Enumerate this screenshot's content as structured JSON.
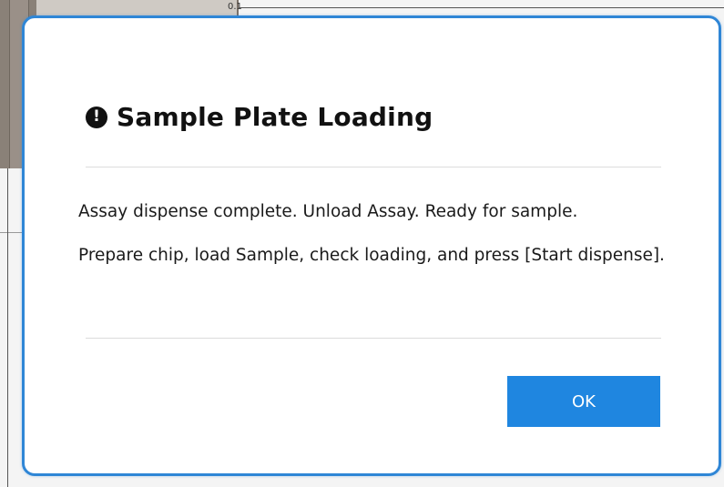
{
  "background": {
    "top_label": "0.1"
  },
  "dialog": {
    "title": "Sample Plate Loading",
    "icon": "exclamation-circle-icon",
    "messages": [
      "Assay dispense complete. Unload Assay. Ready for sample.",
      "Prepare chip, load Sample, check loading, and press [Start dispense]."
    ],
    "ok_label": "OK"
  },
  "colors": {
    "modal_border": "#2f86d6",
    "ok_button": "#1f86e0",
    "icon": "#111111"
  }
}
